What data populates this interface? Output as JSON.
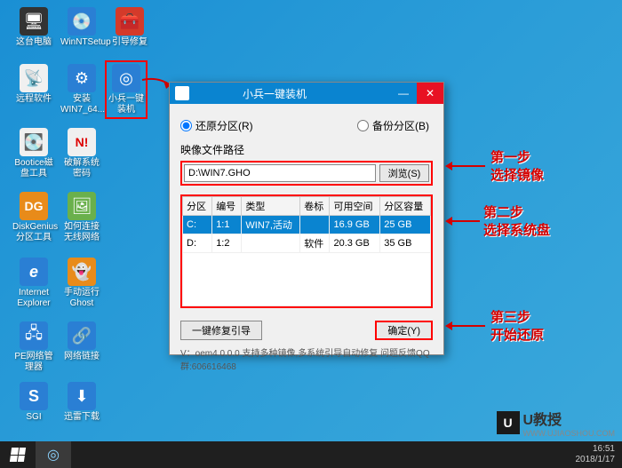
{
  "desktop": {
    "icons": [
      {
        "label": "这台电脑",
        "glyph": "🖥"
      },
      {
        "label": "WinNTSetup",
        "glyph": "💿"
      },
      {
        "label": "引导修复",
        "glyph": "🧰"
      },
      {
        "label": "远程软件",
        "glyph": "📡"
      },
      {
        "label": "安装WIN7_64...",
        "glyph": "⚙"
      },
      {
        "label": "小兵一键装机",
        "glyph": "◎"
      },
      {
        "label": "Bootice磁盘工具",
        "glyph": "💽"
      },
      {
        "label": "破解系统密码",
        "glyph": "N!"
      },
      {
        "label": "DiskGenius分区工具",
        "glyph": "DG"
      },
      {
        "label": "如何连接无线网络",
        "glyph": "🖼"
      },
      {
        "label": "Internet Explorer",
        "glyph": "e"
      },
      {
        "label": "手动运行Ghost",
        "glyph": "👻"
      },
      {
        "label": "PE网络管理器",
        "glyph": "🖧"
      },
      {
        "label": "网络链接",
        "glyph": "🔗"
      },
      {
        "label": "SGI",
        "glyph": "S"
      },
      {
        "label": "迅雷下载",
        "glyph": "⬇"
      }
    ]
  },
  "window": {
    "title": "小兵一键装机",
    "radio_restore": "还原分区(R)",
    "radio_backup": "备份分区(B)",
    "path_label": "映像文件路径",
    "path_value": "D:\\WIN7.GHO",
    "browse_btn": "浏览(S)",
    "columns": [
      "分区",
      "编号",
      "类型",
      "卷标",
      "可用空间",
      "分区容量"
    ],
    "rows": [
      {
        "part": "C:",
        "num": "1:1",
        "type": "WIN7,活动",
        "vol": "",
        "free": "16.9 GB",
        "size": "25 GB",
        "selected": true
      },
      {
        "part": "D:",
        "num": "1:2",
        "type": "",
        "vol": "软件",
        "free": "20.3 GB",
        "size": "35 GB",
        "selected": false
      }
    ],
    "repair_btn": "一键修复引导",
    "ok_btn": "确定(Y)",
    "version_line": "V：oem4.0.0.0      支持多种镜像,多系统引导自动修复  问题反馈QQ群:606616468"
  },
  "annotations": {
    "step1_title": "第一步",
    "step1_text": "选择镜像",
    "step2_title": "第二步",
    "step2_text": "选择系统盘",
    "step3_title": "第三步",
    "step3_text": "开始还原"
  },
  "watermark": {
    "logo_letter": "U",
    "text": "U教授",
    "url": "WWW.UJIAOSHOU.COM"
  },
  "taskbar": {
    "time": "16:51",
    "date": "2018/1/17"
  }
}
